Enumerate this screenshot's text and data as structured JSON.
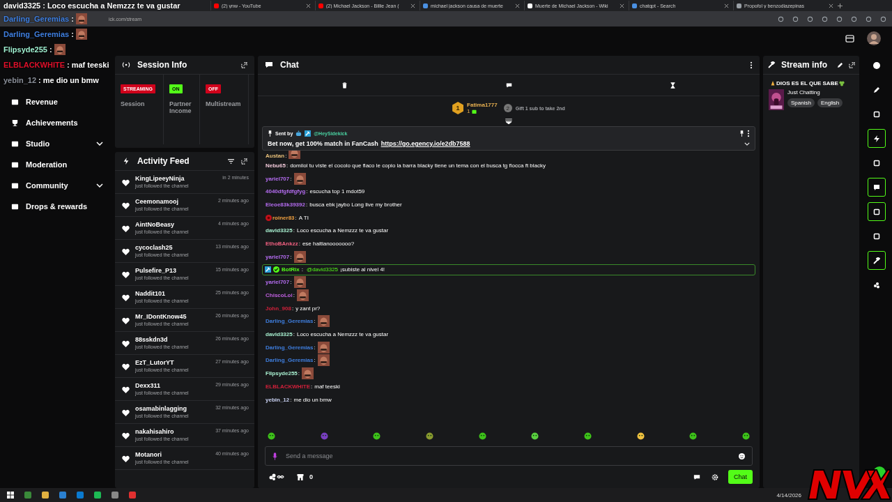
{
  "browser": {
    "tabs": [
      {
        "title": "(2) ynw - YouTube",
        "kind": "youtube"
      },
      {
        "title": "(2) Michael Jackson - Billie Jean (",
        "kind": "youtube"
      },
      {
        "title": "michael jackson causa de muerte",
        "kind": "search"
      },
      {
        "title": "Muerte de Michael Jackson - Wiki",
        "kind": "wiki"
      },
      {
        "title": "chatgpt - Search",
        "kind": "search"
      },
      {
        "title": "Propofol y benzodiazepinas",
        "kind": "page"
      }
    ],
    "address": "ick.com/stream"
  },
  "overlay": [
    {
      "user": "david3325",
      "color": "#ffffff",
      "text": "Loco escucha a Nemzzz te va gustar",
      "kind": "text"
    },
    {
      "user": "Darling_Geremias",
      "color": "#3f7fe0",
      "kind": "emote"
    },
    {
      "user": "Darling_Geremias",
      "color": "#3f7fe0",
      "kind": "emote"
    },
    {
      "user": "Flipsyde255",
      "color": "#9ff0d0",
      "kind": "emote"
    },
    {
      "user": "ELBLACKWHITE",
      "color": "#e0102a",
      "text": "maf teeski",
      "kind": "text"
    },
    {
      "user": "yebin_12",
      "color": "#8a8f99",
      "text": "me dio un bmw",
      "kind": "text"
    }
  ],
  "sidebar": {
    "items": [
      {
        "label": "Revenue",
        "expandable": false
      },
      {
        "label": "Achievements",
        "expandable": false
      },
      {
        "label": "Studio",
        "expandable": true
      },
      {
        "label": "Moderation",
        "expandable": false
      },
      {
        "label": "Community",
        "expandable": true
      },
      {
        "label": "Drops & rewards",
        "expandable": false
      }
    ]
  },
  "session_info": {
    "title": "Session Info",
    "items": [
      {
        "badge": "STREAMING",
        "color": "#d0021b",
        "label": "Session"
      },
      {
        "badge": "ON",
        "color": "#53fc18",
        "label": "Partner Income"
      },
      {
        "badge": "OFF",
        "color": "#d0021b",
        "label": "Multistream"
      }
    ]
  },
  "activity_feed": {
    "title": "Activity Feed",
    "items": [
      {
        "user": "KingLipeeyNinja",
        "action": "just followed the channel",
        "time": "in 2 minutes"
      },
      {
        "user": "Ceemonamooj",
        "action": "just followed the channel",
        "time": "2 minutes ago"
      },
      {
        "user": "AintNoBeasy",
        "action": "just followed the channel",
        "time": "4 minutes ago"
      },
      {
        "user": "cycoclash25",
        "action": "just followed the channel",
        "time": "13 minutes ago"
      },
      {
        "user": "Pulsefire_P13",
        "action": "just followed the channel",
        "time": "15 minutes ago"
      },
      {
        "user": "Naddit101",
        "action": "just followed the channel",
        "time": "25 minutes ago"
      },
      {
        "user": "Mr_IDontKnow45",
        "action": "just followed the channel",
        "time": "26 minutes ago"
      },
      {
        "user": "88sskdn3d",
        "action": "just followed the channel",
        "time": "26 minutes ago"
      },
      {
        "user": "EzT_LutorYT",
        "action": "just followed the channel",
        "time": "27 minutes ago"
      },
      {
        "user": "Dexx311",
        "action": "just followed the channel",
        "time": "29 minutes ago"
      },
      {
        "user": "osamabinlagging",
        "action": "just followed the channel",
        "time": "32 minutes ago"
      },
      {
        "user": "nakahisahiro",
        "action": "just followed the channel",
        "time": "37 minutes ago"
      },
      {
        "user": "Motanori",
        "action": "just followed the channel",
        "time": "40 minutes ago"
      }
    ]
  },
  "chat": {
    "title": "Chat",
    "leader": {
      "rank": "1",
      "user": "Fatima1777",
      "count": "1",
      "next_rank": "2",
      "hint": "Gift 1 sub to take 2nd"
    },
    "pinned": {
      "sent_by": "Sent by",
      "sender": "@HeySidekick",
      "text": "Bet now, get 100% match in FanCash",
      "link": "https://go.egency.io/e2db7588"
    },
    "messages": [
      {
        "user": "Austan",
        "color": "#e8c07a",
        "kind": "emote"
      },
      {
        "user": "Nebu65",
        "color": "#f0c8d8",
        "text": "domilol tu viste el cocolo que flaco le copio la barra blacky tiene un tema con el busca tg flocca ft blacky",
        "kind": "text"
      },
      {
        "user": "yariel707",
        "color": "#b46cf0",
        "kind": "emote"
      },
      {
        "user": "4040dfgfdfgfyg",
        "color": "#b46cf0",
        "text": "escucha top 1 mdot59",
        "kind": "text"
      },
      {
        "user": "Eleoe83k39392",
        "color": "#b46cf0",
        "text": "busca ebk jaybo Long live my brother",
        "kind": "text"
      },
      {
        "user": "roiner83",
        "color": "#f0a040",
        "text": "A TI",
        "kind": "badge"
      },
      {
        "user": "david3325",
        "color": "#a8f0d0",
        "text": "Loco escucha a Nemzzz te va gustar",
        "kind": "text"
      },
      {
        "user": "EthoBAnkzz",
        "color": "#f06080",
        "text": "ese haitianooooooo?",
        "kind": "text"
      },
      {
        "user": "yariel707",
        "color": "#b46cf0",
        "kind": "emote"
      },
      {
        "user": "BotRix",
        "color": "#53fc18",
        "mention": "@david3325",
        "text": "¡subiste al nivel 4!",
        "kind": "bot"
      },
      {
        "user": "yariel707",
        "color": "#b46cf0",
        "kind": "emote"
      },
      {
        "user": "ChiscoLoi",
        "color": "#c060e0",
        "kind": "emote"
      },
      {
        "user": "John_908",
        "color": "#d0203a",
        "text": "y zant pr?",
        "kind": "text"
      },
      {
        "user": "Darling_Geremias",
        "color": "#3f7fe0",
        "kind": "emote"
      },
      {
        "user": "david3325",
        "color": "#a8f0d0",
        "text": "Loco escucha a Nemzzz te va gustar",
        "kind": "text"
      },
      {
        "user": "Darling_Geremias",
        "color": "#3f7fe0",
        "kind": "emote"
      },
      {
        "user": "Darling_Geremias",
        "color": "#3f7fe0",
        "kind": "emote"
      },
      {
        "user": "Flipsyde255",
        "color": "#a8f0d0",
        "kind": "emote"
      },
      {
        "user": "ELBLACKWHITE",
        "color": "#d0203a",
        "text": "maf teeski",
        "kind": "text"
      },
      {
        "user": "yebin_12",
        "color": "#c8d0f0",
        "text": "me dio un bmw",
        "kind": "text"
      }
    ],
    "separator": ":",
    "input": {
      "placeholder": "Send a message"
    },
    "points": "0",
    "send": "Chat"
  },
  "stream_info": {
    "title": "Stream info",
    "stream_title": "DIOS ES EL QUE SABE",
    "category": "Just Chatting",
    "tags": [
      "Spanish",
      "English"
    ]
  },
  "rail": [
    {
      "active": false
    },
    {
      "active": false
    },
    {
      "active": false
    },
    {
      "active": true
    },
    {
      "active": false
    },
    {
      "active": true
    },
    {
      "active": true
    },
    {
      "active": false
    },
    {
      "active": true
    },
    {
      "active": false
    }
  ],
  "taskbar": {
    "date": "4/14/2026"
  },
  "overlay_separator": ":"
}
